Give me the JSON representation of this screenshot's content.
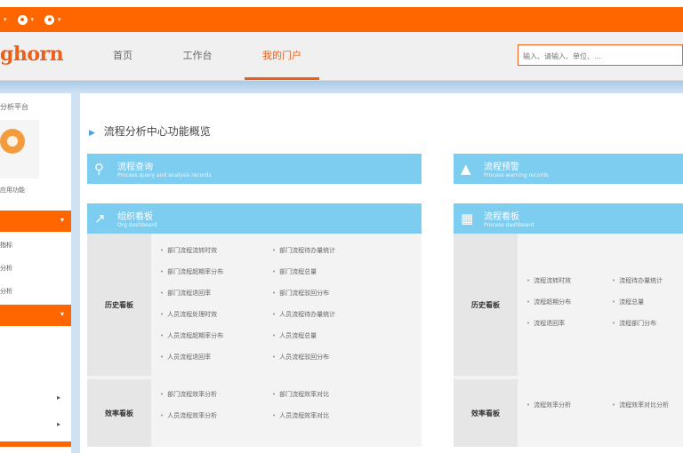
{
  "topbar": {
    "items": [
      {
        "label": "",
        "icon": "app-icon"
      },
      {
        "label": "",
        "icon": "gear-icon"
      },
      {
        "label": "",
        "icon": "gear-icon"
      }
    ]
  },
  "header": {
    "logo": "ghorn",
    "tabs": [
      {
        "label": "首页"
      },
      {
        "label": "工作台"
      },
      {
        "label": "我的门户"
      }
    ],
    "search_placeholder": "输入、请输入、单位、…"
  },
  "sidebar": {
    "title": "分析平台",
    "card_label": "应用功能",
    "section1": "",
    "items": [
      "指标",
      "分析",
      "分析"
    ],
    "section2": ""
  },
  "main": {
    "title": "流程分析中心功能概览",
    "panels": [
      {
        "title": "流程查询",
        "subtitle": "Process query and analysis records",
        "icon": "search-icon"
      },
      {
        "title": "流程预警",
        "subtitle": "Process warning records",
        "icon": "warning-icon"
      },
      {
        "title": "组织看板",
        "subtitle": "Org dashboard",
        "icon": "chart-icon"
      },
      {
        "title": "流程看板",
        "subtitle": "Process dashboard",
        "icon": "dashboard-icon"
      }
    ],
    "left_rows": [
      {
        "label": "历史看板",
        "col1": [
          "部门流程流转时效",
          "部门流程超期率分布",
          "部门流程退回率",
          "人员流程处理时效",
          "人员流程超期率分布",
          "人员流程退回率"
        ],
        "col2": [
          "部门流程待办量统计",
          "部门流程总量",
          "部门流程驳回分布",
          "人员流程待办量统计",
          "人员流程总量",
          "人员流程驳回分布"
        ]
      },
      {
        "label": "效率看板",
        "col1": [
          "部门流程效率分析",
          "人员流程效率分析"
        ],
        "col2": [
          "部门流程效率对比",
          "人员流程效率对比"
        ]
      }
    ],
    "right_rows": [
      {
        "label": "历史看板",
        "col1": [
          "流程流转时效",
          "流程超期分布",
          "流程退回率"
        ],
        "col2": [
          "流程待办量统计",
          "流程总量",
          "流程部门分布"
        ]
      },
      {
        "label": "效率看板",
        "col1": [
          "流程效率分析"
        ],
        "col2": [
          "流程效率对比分析"
        ]
      }
    ]
  }
}
